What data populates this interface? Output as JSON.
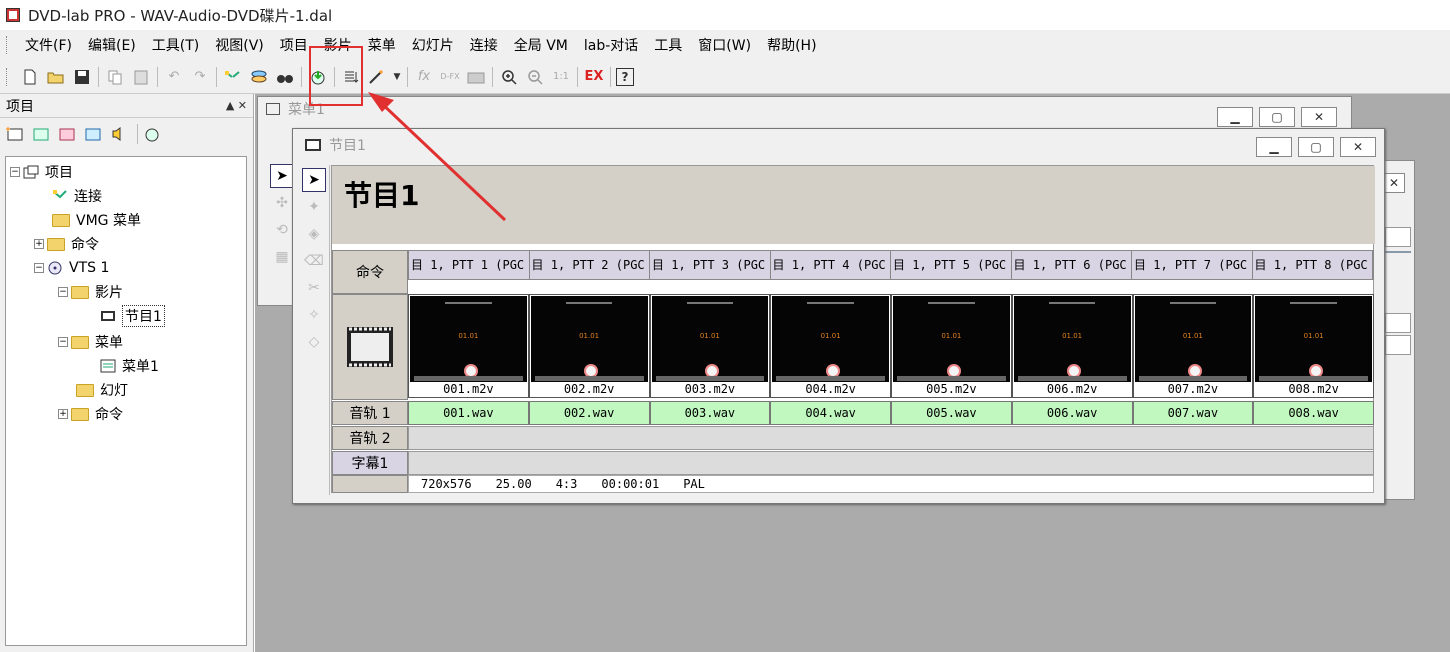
{
  "window": {
    "title": "DVD-lab PRO - WAV-Audio-DVD碟片-1.dal"
  },
  "menu": [
    "文件(F)",
    "编辑(E)",
    "工具(T)",
    "视图(V)",
    "项目",
    "影片",
    "菜单",
    "幻灯片",
    "连接",
    "全局 VM",
    "lab-对话",
    "工具",
    "窗口(W)",
    "帮助(H)"
  ],
  "toolbar": {
    "icons": [
      "new-file-icon",
      "open-folder-icon",
      "save-icon",
      "copy-icon",
      "paste-icon",
      "undo-icon",
      "redo-icon",
      "link-icon",
      "layers-icon",
      "binoculars-icon",
      "compile-disc-icon",
      "list-icon",
      "magic-wand-icon",
      "fx-icon",
      "dfx-icon",
      "camera-icon",
      "zoom-in-icon",
      "zoom-out-icon",
      "zoom-one-icon",
      "pro-ex-icon",
      "help-icon"
    ],
    "zoom_one": "1:1",
    "pro_ex": "EX"
  },
  "project_panel": {
    "title": "项目",
    "tree": {
      "root": "项目",
      "connect": "连接",
      "vmg_menu": "VMG 菜单",
      "commands": "命令",
      "vts": "VTS 1",
      "movies": "影片",
      "movie_item": "节目1",
      "menus": "菜单",
      "menu_item": "菜单1",
      "slides": "幻灯",
      "vts_commands": "命令"
    }
  },
  "back_window": {
    "title": "菜单1"
  },
  "movie_window": {
    "title": "节目1",
    "heading": "节目1",
    "labels": {
      "commands": "命令",
      "audio1": "音轨 1",
      "audio2": "音轨 2",
      "subtitle": "字幕1"
    },
    "commands": [
      "目 1, PTT 1 (PGC",
      "目 1, PTT 2 (PGC",
      "目 1, PTT 3 (PGC",
      "目 1, PTT 4 (PGC",
      "目 1, PTT 5 (PGC",
      "目 1, PTT 6 (PGC",
      "目 1, PTT 7 (PGC",
      "目 1, PTT 8 (PGC"
    ],
    "clips": [
      "001.m2v",
      "002.m2v",
      "003.m2v",
      "004.m2v",
      "005.m2v",
      "006.m2v",
      "007.m2v",
      "008.m2v"
    ],
    "thumb_text": "01.01",
    "audio": [
      "001.wav",
      "002.wav",
      "003.wav",
      "004.wav",
      "005.wav",
      "006.wav",
      "007.wav",
      "008.wav"
    ],
    "status": {
      "resolution": "720x576",
      "fps": "25.00",
      "aspect": "4:3",
      "duration": "00:00:01",
      "standard": "PAL"
    }
  }
}
